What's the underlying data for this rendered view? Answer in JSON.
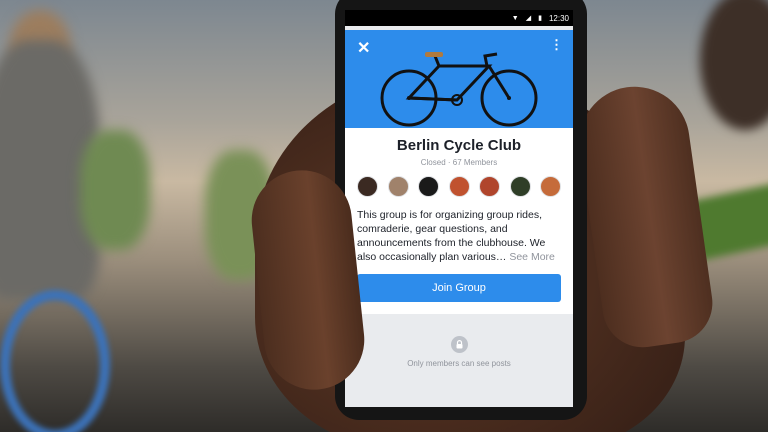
{
  "status_bar": {
    "time": "12:30",
    "wifi_icon": "wifi-icon",
    "signal_icon": "signal-icon",
    "battery_icon": "battery-icon"
  },
  "header": {
    "close_icon": "close-icon",
    "more_icon": "more-vertical-icon",
    "cover_image": "bicycle-image"
  },
  "group": {
    "name": "Berlin Cycle Club",
    "meta": "Closed · 67 Members",
    "members": [
      {
        "color": "#3b2a22"
      },
      {
        "color": "#a0826b"
      },
      {
        "color": "#1a1a1a"
      },
      {
        "color": "#c0522f"
      },
      {
        "color": "#b0452c"
      },
      {
        "color": "#2f3e27"
      },
      {
        "color": "#c56b3a"
      }
    ],
    "description": "This group is for organizing group rides, comraderie, gear questions, and announcements from the clubhouse. We also occasionally plan various…",
    "see_more": "See More",
    "join_label": "Join Group"
  },
  "privacy": {
    "lock_icon": "lock-icon",
    "text": "Only members can see posts"
  },
  "colors": {
    "accent": "#2d8ceb",
    "text": "#1d2129",
    "muted": "#90949c"
  }
}
